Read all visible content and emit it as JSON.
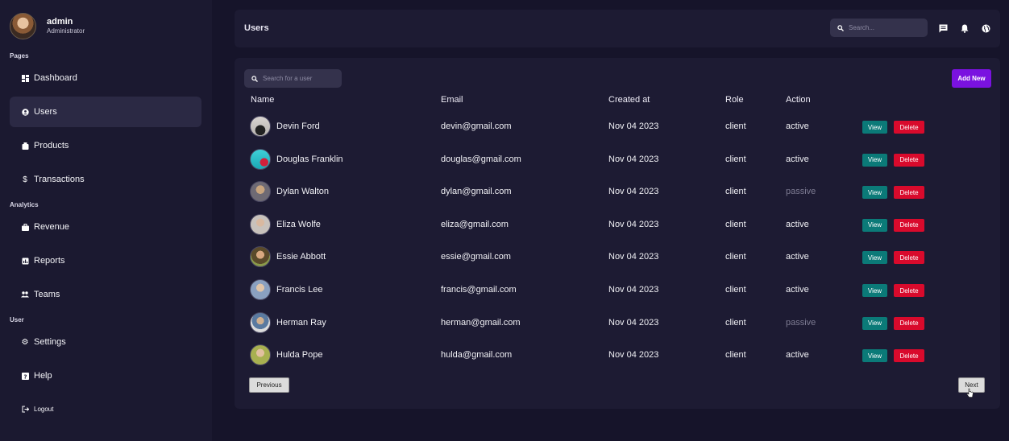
{
  "profile": {
    "name": "admin",
    "role": "Administrator"
  },
  "sections": {
    "pages": "Pages",
    "analytics": "Analytics",
    "user": "User"
  },
  "sidebar": {
    "items": [
      {
        "label": "Dashboard",
        "icon": "dashboard-icon"
      },
      {
        "label": "Users",
        "icon": "users-icon",
        "active": true
      },
      {
        "label": "Products",
        "icon": "products-icon"
      },
      {
        "label": "Transactions",
        "icon": "dollar-icon"
      },
      {
        "label": "Revenue",
        "icon": "briefcase-icon"
      },
      {
        "label": "Reports",
        "icon": "reports-icon"
      },
      {
        "label": "Teams",
        "icon": "teams-icon"
      },
      {
        "label": "Settings",
        "icon": "gear-icon"
      },
      {
        "label": "Help",
        "icon": "help-icon"
      },
      {
        "label": "Logout",
        "icon": "logout-icon"
      }
    ]
  },
  "topbar": {
    "title": "Users",
    "search_placeholder": "Search..."
  },
  "panel": {
    "search_placeholder": "Search for a user",
    "add_new_label": "Add New"
  },
  "table": {
    "headers": [
      "Name",
      "Email",
      "Created at",
      "Role",
      "Action"
    ],
    "rows": [
      {
        "name": "Devin Ford",
        "email": "devin@gmail.com",
        "created": "Nov 04 2023",
        "role": "client",
        "status": "active"
      },
      {
        "name": "Douglas Franklin",
        "email": "douglas@gmail.com",
        "created": "Nov 04 2023",
        "role": "client",
        "status": "active"
      },
      {
        "name": "Dylan Walton",
        "email": "dylan@gmail.com",
        "created": "Nov 04 2023",
        "role": "client",
        "status": "passive"
      },
      {
        "name": "Eliza Wolfe",
        "email": "eliza@gmail.com",
        "created": "Nov 04 2023",
        "role": "client",
        "status": "active"
      },
      {
        "name": "Essie Abbott",
        "email": "essie@gmail.com",
        "created": "Nov 04 2023",
        "role": "client",
        "status": "active"
      },
      {
        "name": "Francis Lee",
        "email": "francis@gmail.com",
        "created": "Nov 04 2023",
        "role": "client",
        "status": "active"
      },
      {
        "name": "Herman Ray",
        "email": "herman@gmail.com",
        "created": "Nov 04 2023",
        "role": "client",
        "status": "passive"
      },
      {
        "name": "Hulda Pope",
        "email": "hulda@gmail.com",
        "created": "Nov 04 2023",
        "role": "client",
        "status": "active"
      }
    ],
    "view_label": "View",
    "delete_label": "Delete"
  },
  "pagination": {
    "previous_label": "Previous",
    "next_label": "Next"
  },
  "colors": {
    "background": "#16142a",
    "sidebar": "#1b1930",
    "panel": "#1d1b33",
    "accent_purple": "#7a12e0",
    "view_teal": "#0b7a78",
    "delete_red": "#d90a2c",
    "passive_text": "#7d7b92"
  }
}
